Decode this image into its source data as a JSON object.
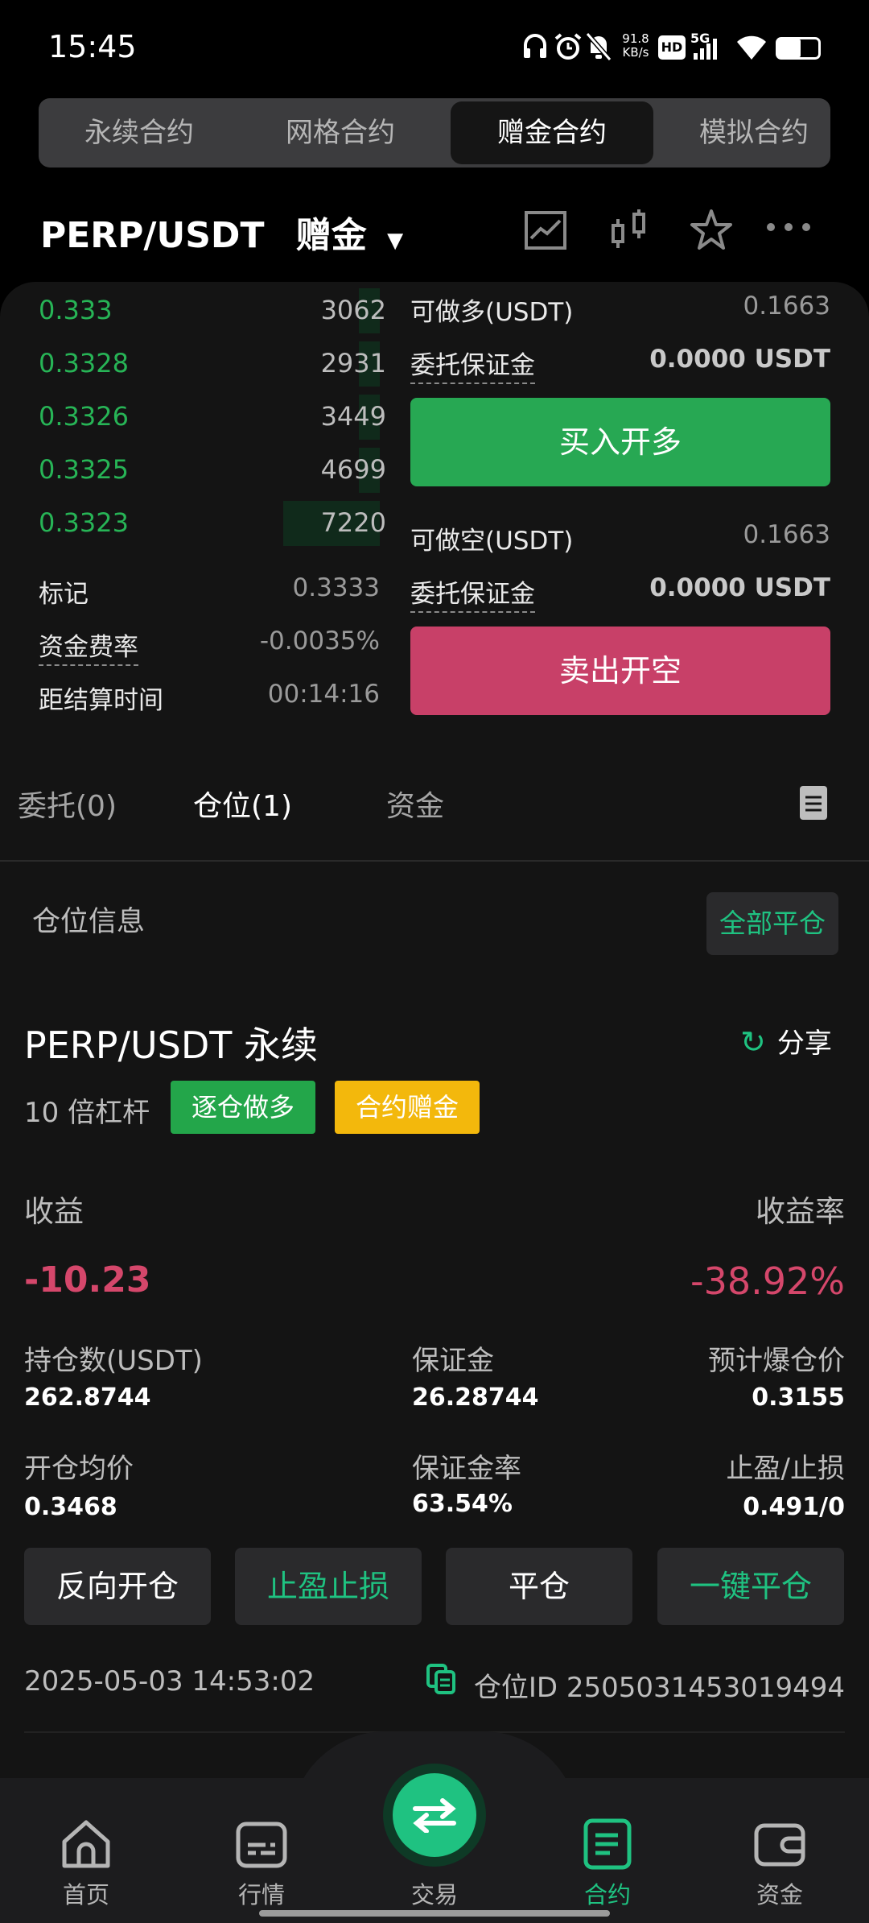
{
  "status_bar": {
    "time": "15:45",
    "net_speed_top": "91.8",
    "net_speed_unit": "KB/s",
    "hd": "HD",
    "network": "5G"
  },
  "segment_tabs": [
    "永续合约",
    "网格合约",
    "赠金合约",
    "模拟合约"
  ],
  "pair": {
    "symbol": "PERP/USDT",
    "tag": "赠金"
  },
  "order_book": [
    {
      "price": "0.333",
      "qty": "3062"
    },
    {
      "price": "0.3328",
      "qty": "2931"
    },
    {
      "price": "0.3326",
      "qty": "3449"
    },
    {
      "price": "0.3325",
      "qty": "4699"
    },
    {
      "price": "0.3323",
      "qty": "7220"
    }
  ],
  "market_info": {
    "mark_label": "标记",
    "mark_value": "0.3333",
    "funding_label": "资金费率",
    "funding_value": "-0.0035%",
    "settle_label": "距结算时间",
    "settle_value": "00:14:16"
  },
  "long": {
    "avail_label": "可做多(USDT)",
    "avail_value": "0.1663",
    "margin_label": "委托保证金",
    "margin_value": "0.0000 USDT",
    "button": "买入开多"
  },
  "short": {
    "avail_label": "可做空(USDT)",
    "avail_value": "0.1663",
    "margin_label": "委托保证金",
    "margin_value": "0.0000 USDT",
    "button": "卖出开空"
  },
  "tabs": {
    "orders": "委托(0)",
    "positions": "仓位(1)",
    "funds": "资金"
  },
  "position": {
    "section_title": "仓位信息",
    "close_all": "全部平仓",
    "title": "PERP/USDT 永续",
    "share": "分享",
    "leverage": "10 倍杠杆",
    "badge_mode": "逐仓做多",
    "badge_bonus": "合约赠金",
    "pnl_label": "收益",
    "pnl_value": "-10.23",
    "roe_label": "收益率",
    "roe_value": "-38.92%",
    "size_label": "持仓数(USDT)",
    "size_value": "262.8744",
    "margin_label": "保证金",
    "margin_value": "26.28744",
    "liq_label": "预计爆仓价",
    "liq_value": "0.3155",
    "entry_label": "开仓均价",
    "entry_value": "0.3468",
    "margin_ratio_label": "保证金率",
    "margin_ratio_value": "63.54%",
    "tpsl_label": "止盈/止损",
    "tpsl_value": "0.491/0",
    "actions": [
      "反向开仓",
      "止盈止损",
      "平仓",
      "一键平仓"
    ],
    "time": "2025-05-03 14:53:02",
    "id_label": "仓位ID 2505031453019494"
  },
  "nav": [
    "首页",
    "行情",
    "交易",
    "合约",
    "资金"
  ],
  "colors": {
    "green": "#27b456",
    "red": "#d5476b",
    "accent": "#1fc281",
    "yellow": "#f3b80c"
  }
}
